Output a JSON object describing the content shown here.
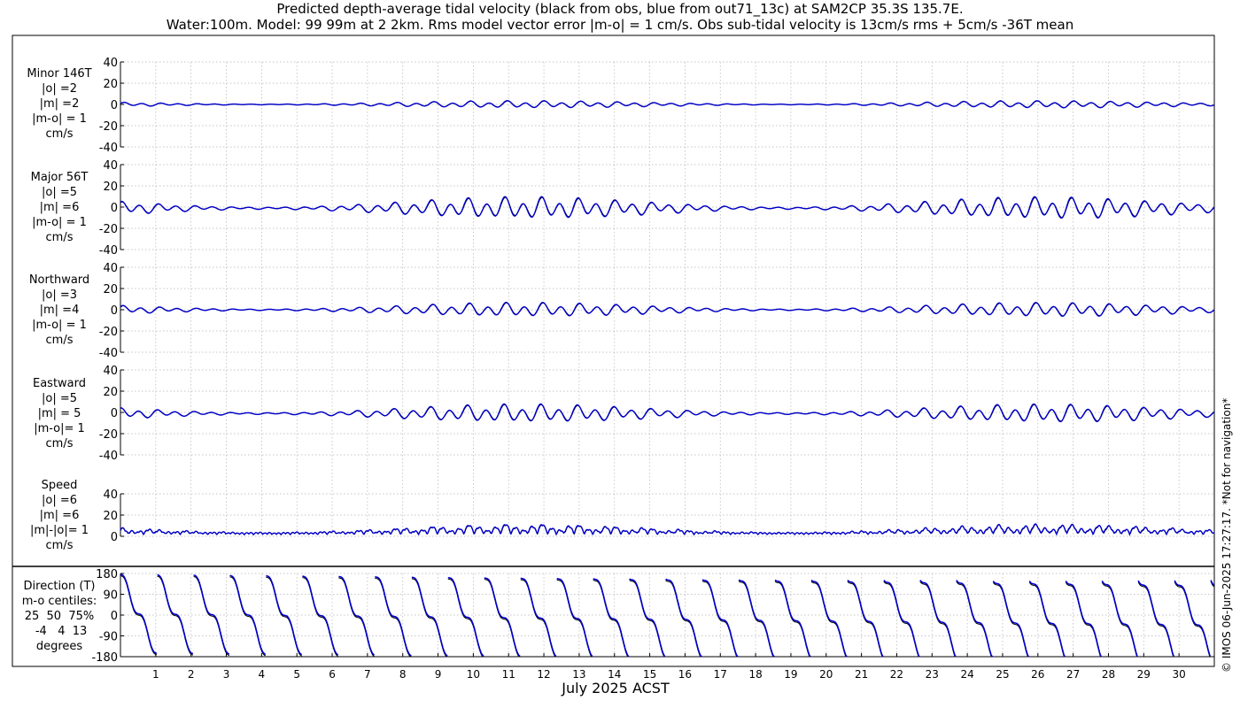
{
  "header": {
    "title_line1": "Predicted depth-average tidal velocity (black from obs, blue from out71_13c) at SAM2CP 35.3S 135.7E.",
    "title_line2": "Water:100m. Model: 99 99m at 2 2km. Rms model vector error |m-o| = 1 cm/s. Obs sub-tidal velocity is 13cm/s rms + 5cm/s -36T mean"
  },
  "panels": {
    "minor": {
      "label": "Minor 146T\n|o| =2\n|m| =2\n|m-o| = 1\ncm/s"
    },
    "major": {
      "label": "Major 56T\n|o| =5\n|m| =6\n|m-o| = 1\ncm/s"
    },
    "northward": {
      "label": "Northward\n|o| =3\n|m| =4\n|m-o| = 1\ncm/s"
    },
    "eastward": {
      "label": "Eastward\n|o| =5\n|m| = 5\n|m-o|= 1\ncm/s"
    },
    "speed": {
      "label": "Speed\n|o| =6\n|m| =6\n|m|-|o|= 1\ncm/s"
    },
    "direction": {
      "label": "Direction (T)\nm-o centiles:\n25  50  75%\n -4   4  13\ndegrees"
    }
  },
  "xaxis": {
    "label": "July 2025 ACST"
  },
  "footer": {
    "copyright": "© IMOS 06-Jun-2025 17:27:17. *Not for navigation*"
  },
  "colors": {
    "obs": "#000000",
    "model": "#0000cc",
    "grid": "#b4b4b4",
    "frame": "#000000"
  },
  "chart_data": [
    {
      "type": "line",
      "name": "Minor 146T",
      "ylim": [
        -40,
        40
      ],
      "yticks": [
        -40,
        -20,
        0,
        20,
        40
      ],
      "x_days": [
        0,
        31
      ],
      "amplitude_cm_s": {
        "obs": 2,
        "model": 2
      },
      "grid": true
    },
    {
      "type": "line",
      "name": "Major 56T",
      "ylim": [
        -40,
        40
      ],
      "yticks": [
        -40,
        -20,
        0,
        20,
        40
      ],
      "x_days": [
        0,
        31
      ],
      "amplitude_cm_s": {
        "obs": 5,
        "model": 6
      },
      "grid": true
    },
    {
      "type": "line",
      "name": "Northward",
      "ylim": [
        -40,
        40
      ],
      "yticks": [
        -40,
        -20,
        0,
        20,
        40
      ],
      "x_days": [
        0,
        31
      ],
      "amplitude_cm_s": {
        "obs": 3,
        "model": 4
      },
      "grid": true
    },
    {
      "type": "line",
      "name": "Eastward",
      "ylim": [
        -40,
        40
      ],
      "yticks": [
        -40,
        -20,
        0,
        20,
        40
      ],
      "x_days": [
        0,
        31
      ],
      "amplitude_cm_s": {
        "obs": 5,
        "model": 5
      },
      "grid": true
    },
    {
      "type": "line",
      "name": "Speed",
      "ylim": [
        0,
        40
      ],
      "yticks": [
        0,
        20,
        40
      ],
      "x_days": [
        0,
        31
      ],
      "amplitude_cm_s": {
        "obs": 6,
        "model": 6
      },
      "grid": true
    },
    {
      "type": "line",
      "name": "Direction (T)",
      "ylim": [
        -180,
        180
      ],
      "yticks": [
        -180,
        -90,
        0,
        90,
        180
      ],
      "x_days": [
        0,
        31
      ],
      "grid": true
    },
    {
      "type": "axis",
      "xlabel": "July 2025 ACST",
      "xticks": [
        1,
        2,
        3,
        4,
        5,
        6,
        7,
        8,
        9,
        10,
        11,
        12,
        13,
        14,
        15,
        16,
        17,
        18,
        19,
        20,
        21,
        22,
        23,
        24,
        25,
        26,
        27,
        28,
        29,
        30
      ]
    }
  ]
}
